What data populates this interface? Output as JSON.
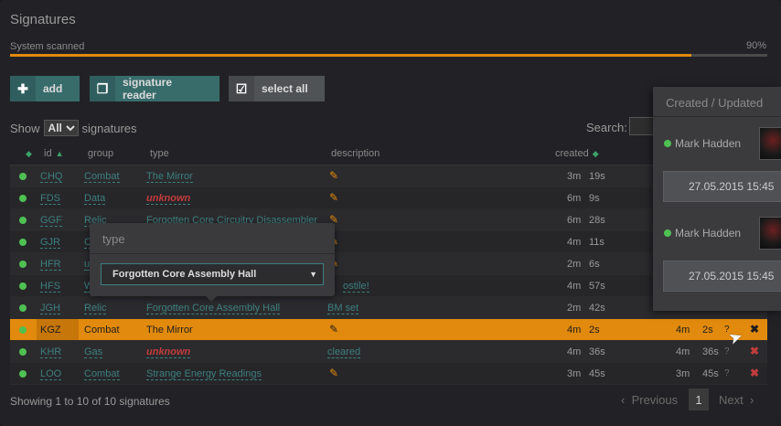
{
  "panel": {
    "title": "Signatures"
  },
  "scan": {
    "label": "System scanned",
    "percent_text": "90%",
    "percent": 90
  },
  "toolbar": {
    "add_label": "add",
    "reader_label": "signature reader",
    "select_all_label": "select all"
  },
  "show": {
    "prefix": "Show",
    "value": "All",
    "suffix": "signatures"
  },
  "search": {
    "label": "Search:"
  },
  "columns": {
    "id": "id",
    "group": "group",
    "type": "type",
    "description": "description",
    "created": "created"
  },
  "rows": [
    {
      "id": "CHQ",
      "group": "Combat",
      "type": "The Mirror",
      "description": "",
      "created_m": "3m",
      "created_s": "19s"
    },
    {
      "id": "FDS",
      "group": "Data",
      "type": "unknown",
      "description": "",
      "created_m": "6m",
      "created_s": "9s"
    },
    {
      "id": "GGF",
      "group": "Relic",
      "type": "Forgotten Core Circuitry Disassembler",
      "description": "",
      "created_m": "6m",
      "created_s": "28s"
    },
    {
      "id": "GJR",
      "group": "C",
      "type": "",
      "description": "",
      "created_m": "4m",
      "created_s": "11s"
    },
    {
      "id": "HFR",
      "group": "u",
      "type": "",
      "description": "",
      "created_m": "2m",
      "created_s": "6s"
    },
    {
      "id": "HFS",
      "group": "W",
      "type": "",
      "description": "ostile!",
      "created_m": "4m",
      "created_s": "57s"
    },
    {
      "id": "JGH",
      "group": "Relic",
      "type": "Forgotten Core Assembly Hall",
      "description": "BM set",
      "created_m": "2m",
      "created_s": "42s"
    },
    {
      "id": "KGZ",
      "group": "Combat",
      "type": "The Mirror",
      "description": "",
      "created_m": "4m",
      "created_s": "2s",
      "updated_m": "4m",
      "updated_s": "2s"
    },
    {
      "id": "KHR",
      "group": "Gas",
      "type": "unknown",
      "description": "cleared",
      "created_m": "4m",
      "created_s": "36s",
      "updated_m": "4m",
      "updated_s": "36s"
    },
    {
      "id": "LOO",
      "group": "Combat",
      "type": "Strange Energy Readings",
      "description": "",
      "created_m": "3m",
      "created_s": "45s",
      "updated_m": "3m",
      "updated_s": "45s"
    }
  ],
  "footer": {
    "info": "Showing 1 to 10 of 10 signatures",
    "prev": "Previous",
    "page": "1",
    "next": "Next"
  },
  "type_popover": {
    "title": "type",
    "selected": "Forgotten Core Assembly Hall"
  },
  "side_panel": {
    "title": "Created / Updated",
    "entries": [
      {
        "user": "Mark Hadden",
        "date": "27.05.2015 15:45"
      },
      {
        "user": "Mark Hadden",
        "date": "27.05.2015 15:45"
      }
    ]
  },
  "colors": {
    "accent": "#e28a0d",
    "teal": "#376c6b",
    "online": "#4fc152",
    "danger": "#c23c3c"
  }
}
